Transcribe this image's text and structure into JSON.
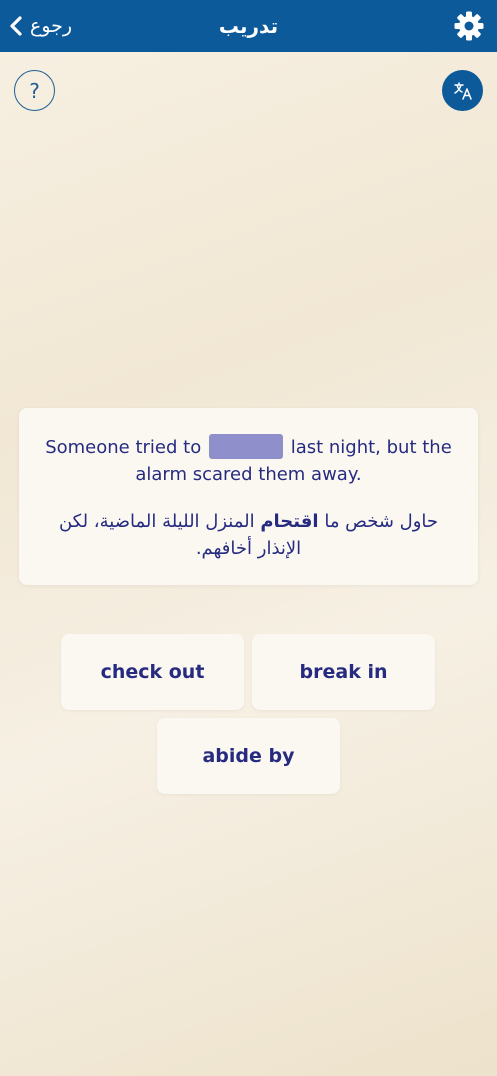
{
  "header": {
    "back_label": "رجوع",
    "title": "تدريب",
    "settings_icon": "gear-icon",
    "background": "#0d5a9b"
  },
  "help": {
    "label": "?"
  },
  "translate": {
    "icon": "translate-icon"
  },
  "question": {
    "en_before": "Someone tried to",
    "en_after": "last night, but the alarm scared them away.",
    "ar_before": "حاول شخص ما",
    "ar_highlight": "اقتحام",
    "ar_after": "المنزل الليلة الماضية، لكن الإنذار أخافهم."
  },
  "options": [
    "check out",
    "break in",
    "abide by"
  ],
  "colors": {
    "accent": "#262b80",
    "blank": "#8f8fcb"
  }
}
